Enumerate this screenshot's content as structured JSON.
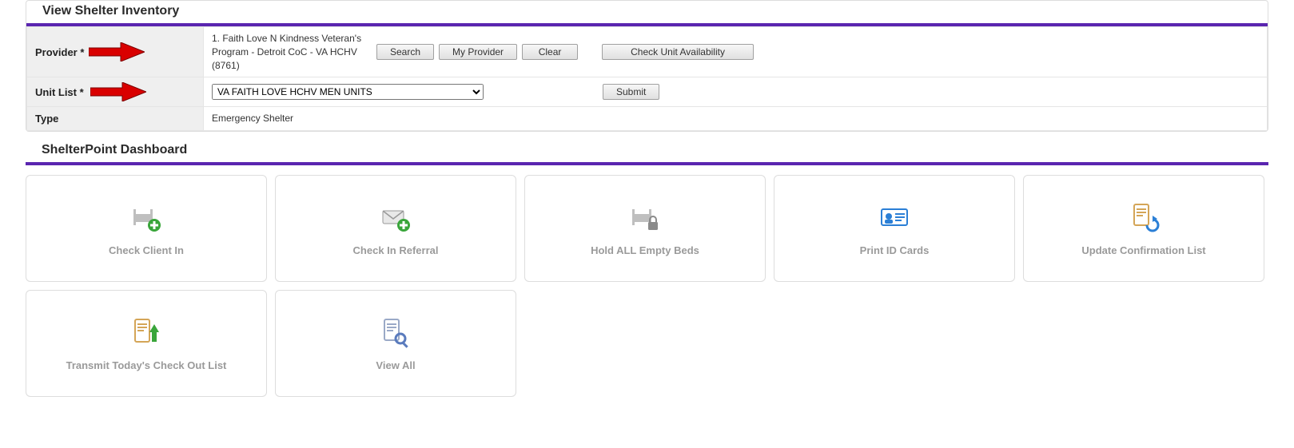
{
  "inventory": {
    "title": "View Shelter Inventory",
    "rows": {
      "provider_label": "Provider *",
      "provider_value": "1. Faith Love N Kindness Veteran's Program - Detroit CoC - VA HCHV (8761)",
      "unit_list_label": "Unit List *",
      "unit_list_value": "VA FAITH LOVE HCHV MEN UNITS",
      "type_label": "Type",
      "type_value": "Emergency Shelter"
    },
    "buttons": {
      "search": "Search",
      "my_provider": "My Provider",
      "clear": "Clear",
      "check_availability": "Check Unit Availability",
      "submit": "Submit"
    }
  },
  "dashboard": {
    "title": "ShelterPoint Dashboard",
    "cards": [
      {
        "label": "Check Client In",
        "icon": "bed-plus"
      },
      {
        "label": "Check In Referral",
        "icon": "mail-plus"
      },
      {
        "label": "Hold ALL Empty Beds",
        "icon": "bed-lock"
      },
      {
        "label": "Print ID Cards",
        "icon": "id-card"
      },
      {
        "label": "Update Confirmation List",
        "icon": "doc-refresh"
      },
      {
        "label": "Transmit Today's Check Out List",
        "icon": "doc-up"
      },
      {
        "label": "View All",
        "icon": "doc-search"
      }
    ]
  },
  "colors": {
    "accent": "#5a25b0",
    "card_text": "#9a9a9a"
  }
}
